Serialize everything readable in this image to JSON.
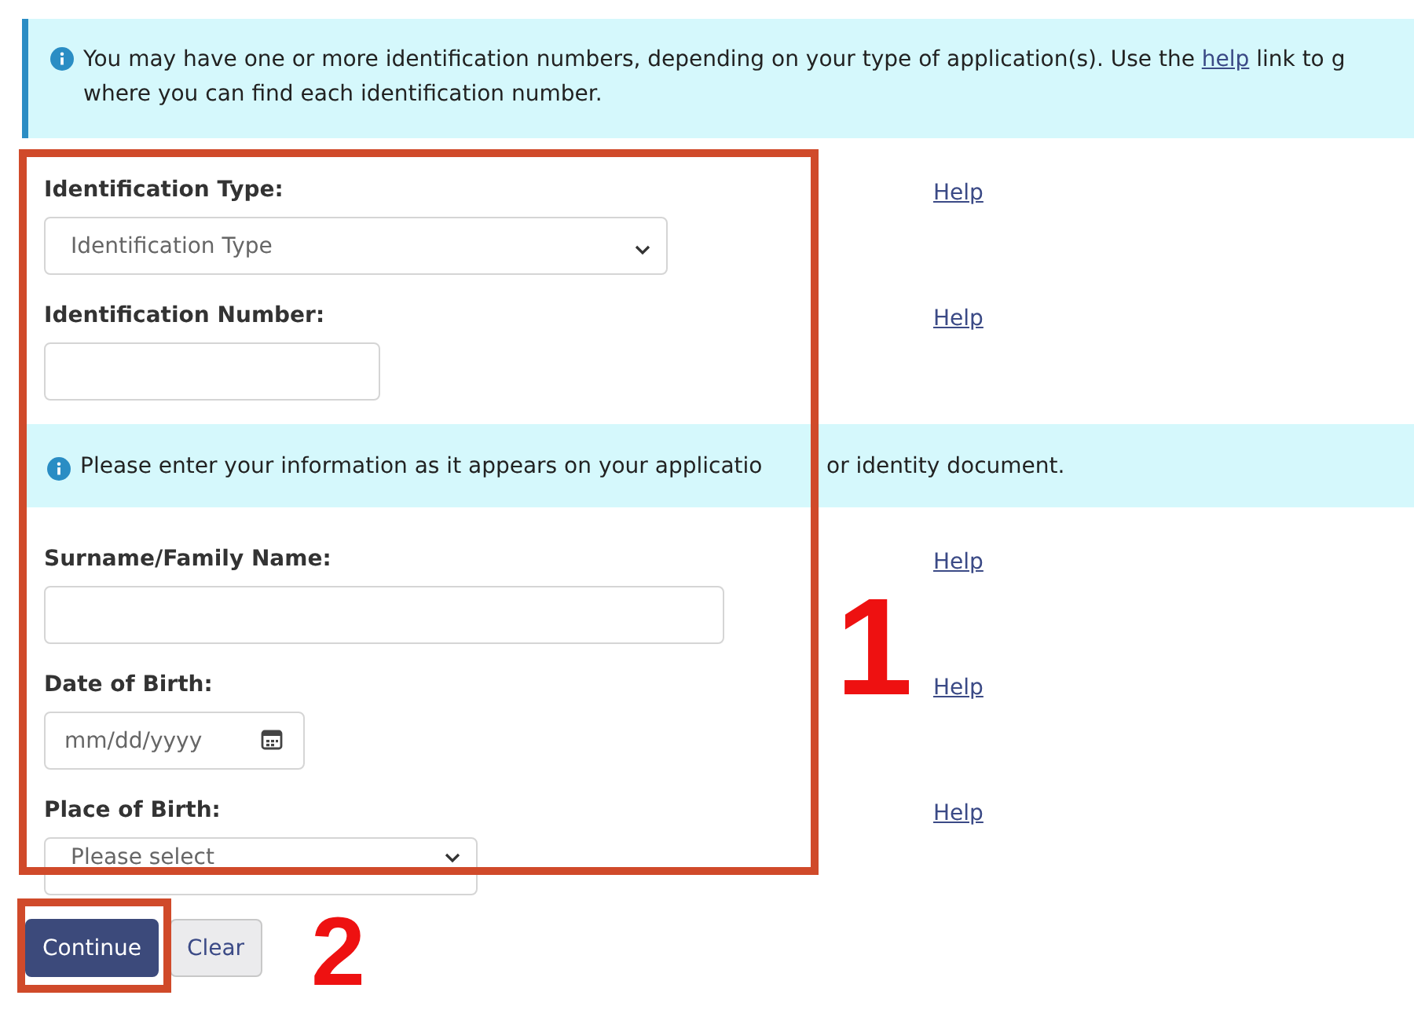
{
  "notice_top": {
    "line_1_before": "You may have one or more identification numbers, depending on your type of application(s). Use the ",
    "link": "help",
    "line_1_after": " link to g",
    "line_2": "where you can find each identification number."
  },
  "fields_1": [
    {
      "kind": "select",
      "label": "Identification Type:",
      "value": "Identification Type",
      "help": "Help"
    },
    {
      "kind": "text",
      "label": "Identification Number:",
      "help": "Help"
    }
  ],
  "notice_middle": {
    "text_left": "Please enter your information as it appears on your applicatio",
    "text_right": "or identity document."
  },
  "fields_2": [
    {
      "kind": "wide-text",
      "label": "Surname/Family Name:",
      "help": "Help"
    },
    {
      "kind": "date",
      "label": "Date of Birth:",
      "placeholder": "mm/dd/yyyy",
      "help": "Help"
    },
    {
      "kind": "short-select",
      "label": "Place of Birth:",
      "value": "Please select",
      "help": "Help"
    }
  ],
  "buttons": [
    {
      "kind": "primary",
      "label": "Continue"
    },
    {
      "kind": "secondary",
      "label": "Clear"
    }
  ],
  "callouts": [
    "1",
    "2"
  ]
}
